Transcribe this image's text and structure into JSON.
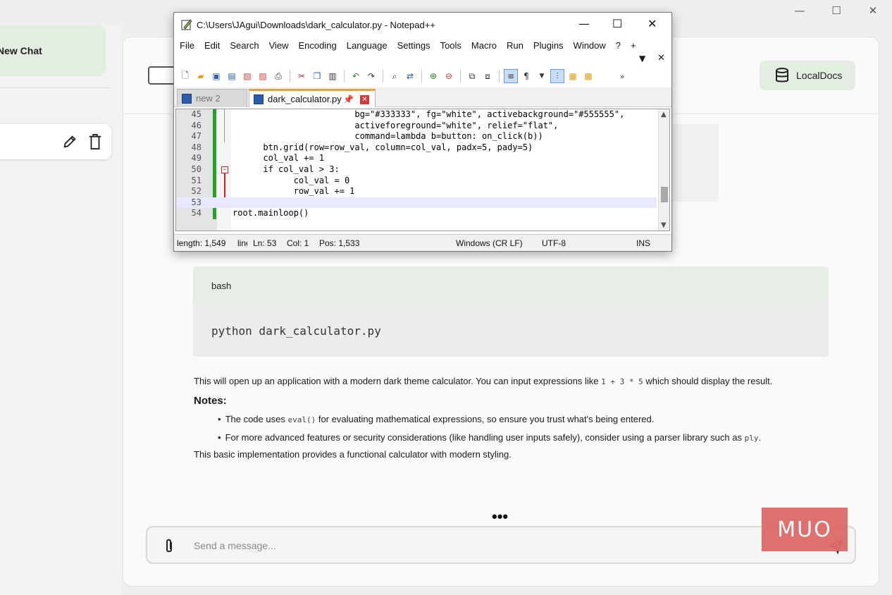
{
  "app": {
    "new_chat_label": "New Chat",
    "localdocs_label": "LocalDocs"
  },
  "code_block": {
    "language": "bash",
    "command": "python dark_calculator.py"
  },
  "answer": {
    "intro_before": "This will open up an application with a modern dark theme calculator. You can input expressions like",
    "intro_code": "1 + 3 * 5",
    "intro_after": "which should display the result.",
    "notes_heading": "Notes:",
    "note1_before": "The code uses",
    "note1_code": "eval()",
    "note1_after": "for evaluating mathematical expressions, so ensure you trust what's being entered.",
    "note2_before": "For more advanced features or security considerations (like handling user inputs safely), consider using a parser library such as",
    "note2_code": "ply",
    "note2_after": ".",
    "closing": "This basic implementation provides a functional calculator with modern styling."
  },
  "typing_indicator": "•••",
  "composer": {
    "placeholder": "Send a message..."
  },
  "watermark": "MUO",
  "npp": {
    "title": "C:\\Users\\JAgui\\Downloads\\dark_calculator.py - Notepad++",
    "menu": [
      "File",
      "Edit",
      "Search",
      "View",
      "Encoding",
      "Language",
      "Settings",
      "Tools",
      "Macro",
      "Run",
      "Plugins",
      "Window",
      "?"
    ],
    "menu_plus": "+",
    "tabs": {
      "inactive": "new 2",
      "active": "dark_calculator.py"
    },
    "lines": [
      {
        "n": "45",
        "text": "                        bg=\"#333333\", fg=\"white\", activebackground=\"#555555\","
      },
      {
        "n": "46",
        "text": "                        activeforeground=\"white\", relief=\"flat\","
      },
      {
        "n": "47",
        "text": "                        command=lambda b=button: on_click(b))"
      },
      {
        "n": "48",
        "text": "      btn.grid(row=row_val, column=col_val, padx=5, pady=5)"
      },
      {
        "n": "49",
        "text": "      col_val += 1"
      },
      {
        "n": "50",
        "text": "      if col_val > 3:"
      },
      {
        "n": "51",
        "text": "            col_val = 0"
      },
      {
        "n": "52",
        "text": "            row_val += 1"
      },
      {
        "n": "53",
        "text": ""
      },
      {
        "n": "54",
        "text": "root.mainloop()"
      }
    ],
    "status": {
      "length": "length: 1,549",
      "lines": "line",
      "ln": "Ln: 53",
      "col": "Col: 1",
      "pos": "Pos: 1,533",
      "eol": "Windows (CR LF)",
      "encoding": "UTF-8",
      "mode": "INS"
    }
  }
}
